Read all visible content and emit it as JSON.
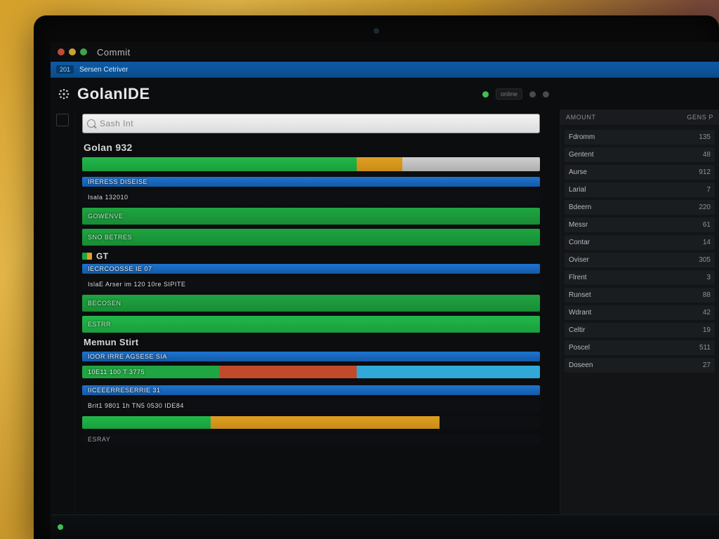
{
  "window": {
    "title": "Commit"
  },
  "tab_strip": {
    "badge": "201",
    "label": "Sersen Cetriver"
  },
  "brand": {
    "title": "GolanIDE"
  },
  "header_right": {
    "chip": "",
    "status": "online"
  },
  "search": {
    "placeholder": "Sash Int"
  },
  "sections": [
    {
      "title": "Golan 932",
      "bars": [
        {
          "segments": [
            {
              "color": "c-green2",
              "width_pct": 60
            },
            {
              "color": "c-orange",
              "width_pct": 10
            },
            {
              "color": "c-grey",
              "width_pct": 30
            }
          ],
          "height": "two-seg"
        },
        {
          "label": "IRERESS DISEISE",
          "color": "c-blue",
          "width_pct": 100,
          "thin": true
        },
        {
          "label": "Isala 132010",
          "color": "c-dark",
          "width_pct": 100
        },
        {
          "label": "Gowenve",
          "color": "c-green",
          "width_pct": 100
        },
        {
          "label": "Sno Betres",
          "color": "c-green",
          "width_pct": 100
        }
      ]
    },
    {
      "title": "GT",
      "badge": true,
      "bars": [
        {
          "label": "IECRCOOSSE IE 07",
          "color": "c-blue",
          "width_pct": 100,
          "thin": true
        },
        {
          "label": "IslaE Arser im 120 10re SIPITE",
          "color": "c-dark",
          "width_pct": 100
        },
        {
          "label": "Becosen",
          "color": "c-green",
          "width_pct": 100
        },
        {
          "label": "Estrr",
          "color": "c-green2",
          "width_pct": 100
        }
      ]
    },
    {
      "title": "Memun Stirt",
      "bars": [
        {
          "label": "IOOR IRRE AGSESE SIA",
          "color": "c-blue",
          "width_pct": 100,
          "thin": true
        },
        {
          "label": "10E11 100 T 3775",
          "colors": [
            "#1fa541",
            "#c24a2a",
            "#30a9d8"
          ],
          "width_pct": 100,
          "multi": true
        }
      ]
    },
    {
      "title": "",
      "bars": [
        {
          "label": "IICEEERRESERRIE 31",
          "color": "c-blue",
          "width_pct": 100,
          "thin": true
        },
        {
          "label": "Brit1 9801 1h TN5 0530 IDE84",
          "color": "c-dark",
          "width_pct": 100
        },
        {
          "segments": [
            {
              "color": "c-green2",
              "width_pct": 28
            },
            {
              "color": "c-orange",
              "width_pct": 50
            },
            {
              "color": "c-dark",
              "width_pct": 22
            }
          ],
          "height": "two-seg"
        },
        {
          "label": "Esray",
          "color": "c-dark",
          "width_pct": 100
        }
      ]
    }
  ],
  "sidebar": {
    "head_left": "Amount",
    "head_right": "GENS  P",
    "rows": [
      {
        "k": "Fdromm",
        "v": "135"
      },
      {
        "k": "Gentent",
        "v": "48"
      },
      {
        "k": "Aurse",
        "v": "912"
      },
      {
        "k": "Larial",
        "v": "7"
      },
      {
        "k": "Bdeern",
        "v": "220"
      },
      {
        "k": "Messr",
        "v": "61"
      },
      {
        "k": "Contar",
        "v": "14"
      },
      {
        "k": "Oviser",
        "v": "305"
      },
      {
        "k": "Flrent",
        "v": "3"
      },
      {
        "k": "Runset",
        "v": "88"
      },
      {
        "k": "Wdrant",
        "v": "42"
      },
      {
        "k": "Celtir",
        "v": "19"
      },
      {
        "k": "Poscel",
        "v": "511"
      },
      {
        "k": "Doseen",
        "v": "27"
      }
    ]
  },
  "status": {
    "hint": ""
  },
  "colors": {
    "accent_green": "#1fa541",
    "accent_blue": "#1d74d1",
    "accent_orange": "#dfa021"
  }
}
